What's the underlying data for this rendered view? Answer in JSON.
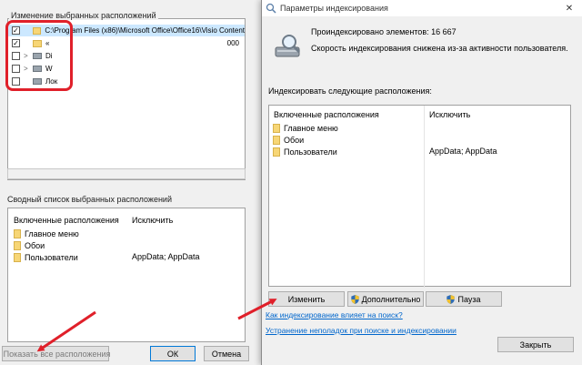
{
  "left_dialog": {
    "tree_group_label": "Изменение выбранных расположений",
    "tree_items": [
      {
        "label": "C:\\Program Files (x86)\\Microsoft Office\\Office16\\Visio Content",
        "checked": true,
        "extra": ""
      },
      {
        "label": "«",
        "checked": true,
        "extra": "000"
      },
      {
        "label": "Di",
        "checked": false,
        "extra": ""
      },
      {
        "label": "W",
        "checked": false,
        "extra": ""
      },
      {
        "label": "Лок",
        "checked": false,
        "extra": ""
      }
    ],
    "summary_group_label": "Сводный список выбранных расположений",
    "col_included": "Включенные расположения",
    "col_exclude": "Исключить",
    "locations": [
      {
        "name": "Главное меню",
        "exclude": ""
      },
      {
        "name": "Обои",
        "exclude": ""
      },
      {
        "name": "Пользователи",
        "exclude": "AppData; AppData"
      }
    ],
    "show_all_button": "Показать все расположения",
    "ok_button": "ОК",
    "cancel_button": "Отмена"
  },
  "dialog": {
    "title": "Параметры индексирования",
    "close_glyph": "✕",
    "indexed_count": "Проиндексировано элементов: 16 667",
    "status": "Скорость индексирования снижена из-за активности пользователя.",
    "index_label": "Индексировать следующие расположения:",
    "col_included": "Включенные расположения",
    "col_exclude": "Исключить",
    "locations": [
      {
        "name": "Главное меню",
        "exclude": ""
      },
      {
        "name": "Обои",
        "exclude": ""
      },
      {
        "name": "Пользователи",
        "exclude": "AppData; AppData"
      }
    ],
    "modify_button": "Изменить",
    "advanced_button": "Дополнительно",
    "pause_button": "Пауза",
    "link_search": "Как индексирование влияет на поиск?",
    "link_troubleshoot": "Устранение неполадок при поиске и индексировании",
    "close_button": "Закрыть"
  },
  "colors": {
    "annotation_red": "#e0202a",
    "link_blue": "#0066cc",
    "selection": "#cce8ff"
  },
  "icons": {
    "folder": "folder-icon",
    "drive": "drive-icon",
    "shield": "uac-shield-icon",
    "indexing": "indexing-magnifier-icon"
  }
}
